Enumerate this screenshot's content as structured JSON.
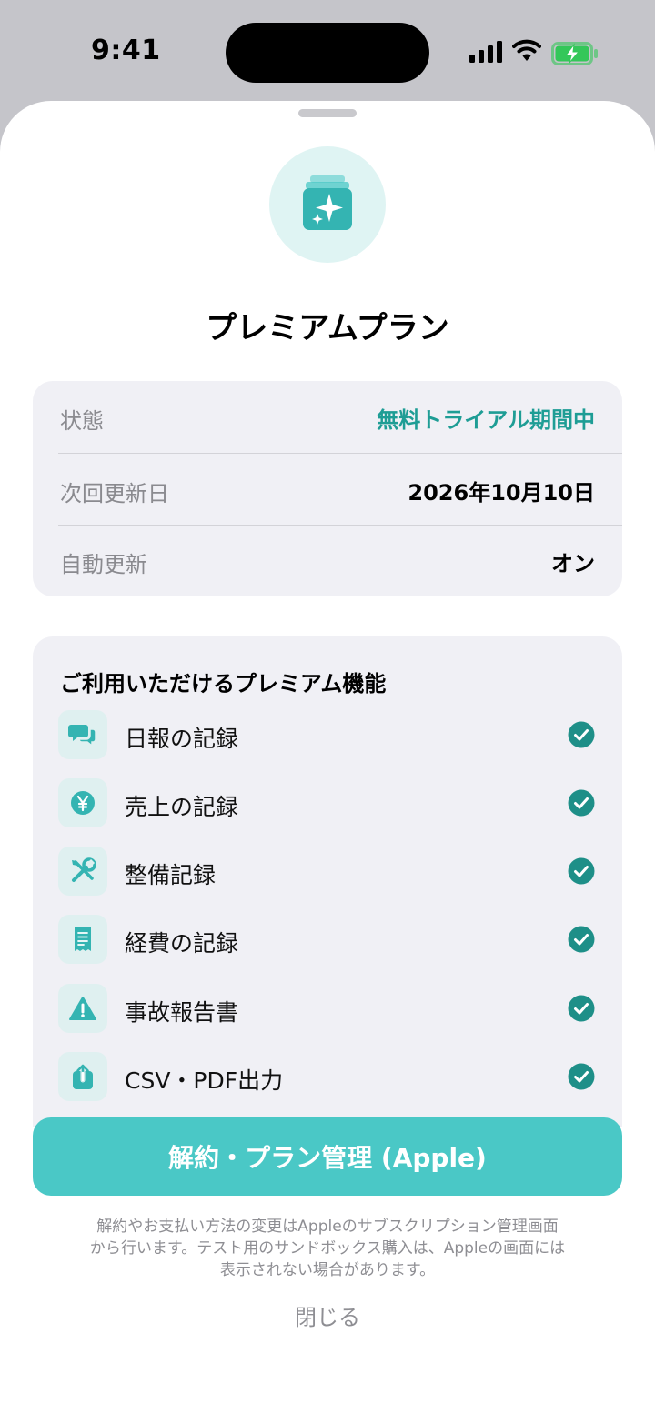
{
  "status_bar": {
    "time": "9:41"
  },
  "sheet": {
    "title": "プレミアムプラン",
    "info": [
      {
        "label": "状態",
        "value": "無料トライアル期間中",
        "accent": true
      },
      {
        "label": "次回更新日",
        "value": "2026年10月10日",
        "accent": false
      },
      {
        "label": "自動更新",
        "value": "オン",
        "accent": false
      }
    ],
    "features_heading": "ご利用いただけるプレミアム機能",
    "features": [
      {
        "label": "日報の記録",
        "icon": "chat-bubbles-icon",
        "included": true
      },
      {
        "label": "売上の記録",
        "icon": "yen-coin-icon",
        "included": true
      },
      {
        "label": "整備記録",
        "icon": "wrench-screwdriver-icon",
        "included": true
      },
      {
        "label": "経費の記録",
        "icon": "receipt-icon",
        "included": true
      },
      {
        "label": "事故報告書",
        "icon": "warning-icon",
        "included": true
      },
      {
        "label": "CSV・PDF出力",
        "icon": "share-export-icon",
        "included": true
      }
    ],
    "manage_button": "解約・プラン管理 (Apple)",
    "footnote": [
      "解約やお支払い方法の変更はAppleのサブスクリプション管理画面",
      "から行います。テスト用のサンドボックス購入は、Appleの画面には",
      "表示されない場合があります。"
    ],
    "close": "閉じる"
  },
  "colors": {
    "accent": "#1e9d95",
    "button": "#4ac8c6",
    "icon_bg": "#dff0f0",
    "card_bg": "#f0f0f5"
  }
}
